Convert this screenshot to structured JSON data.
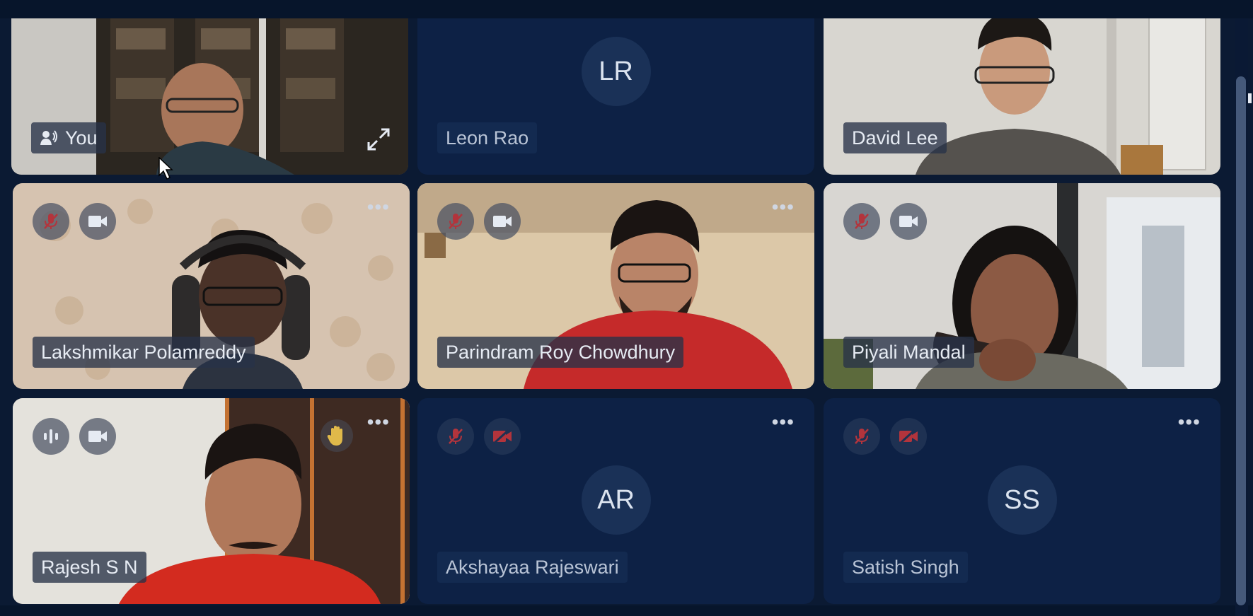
{
  "participants": [
    {
      "name": "You",
      "type": "video",
      "speaking": true,
      "has_expand": true
    },
    {
      "name": "Leon Rao",
      "type": "avatar",
      "initials": "LR"
    },
    {
      "name": "David Lee",
      "type": "video"
    },
    {
      "name": "Lakshmikar Polamreddy",
      "type": "video",
      "mic": "muted",
      "camera": "on"
    },
    {
      "name": "Parindram Roy Chowdhury",
      "type": "video",
      "mic": "muted",
      "camera": "on"
    },
    {
      "name": "Piyali Mandal",
      "type": "video",
      "mic": "muted",
      "camera": "on"
    },
    {
      "name": "Rajesh S N",
      "type": "video",
      "mic": "speaking",
      "camera": "on",
      "hand_raised": true
    },
    {
      "name": "Akshayaa Rajeswari",
      "type": "avatar",
      "initials": "AR",
      "mic": "muted",
      "camera": "off"
    },
    {
      "name": "Satish Singh",
      "type": "avatar",
      "initials": "SS",
      "mic": "muted",
      "camera": "off"
    }
  ],
  "icons": {
    "speaking": "speaking-person-icon",
    "expand": "expand-icon",
    "mic_muted": "mic-muted-icon",
    "mic_active": "audio-level-icon",
    "camera_on": "camera-icon",
    "camera_off": "camera-off-icon",
    "more": "more-options-icon",
    "hand": "raised-hand-icon"
  },
  "colors": {
    "background": "#0b1a33",
    "tile_avatar": "#0d2145",
    "muted_red": "#b3343c",
    "hand_yellow": "#e0b94a",
    "scrollbar_thumb": "#45597a"
  },
  "more_glyph": "•••"
}
